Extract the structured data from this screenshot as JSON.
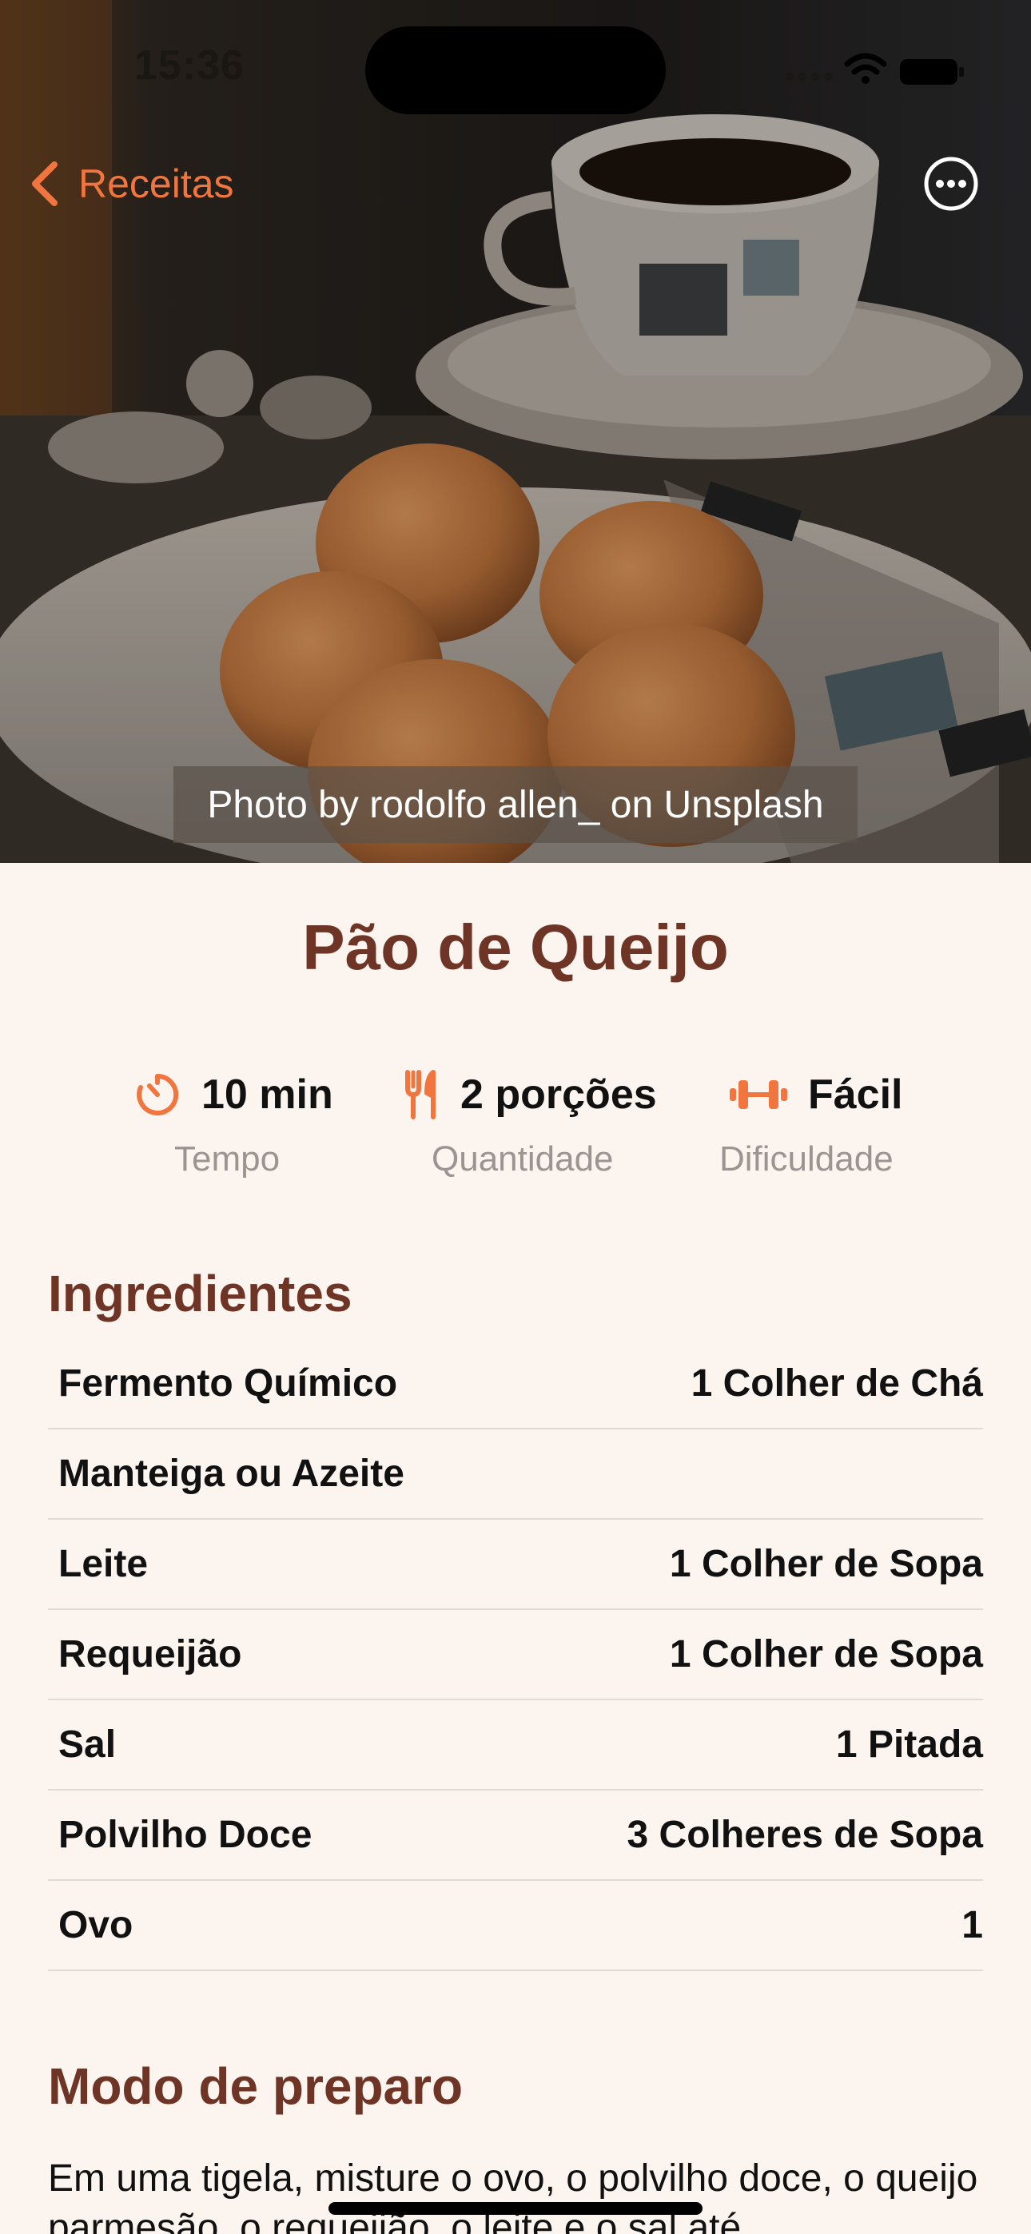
{
  "status_bar": {
    "time": "15:36"
  },
  "nav": {
    "back_label": "Receitas"
  },
  "hero": {
    "photo_credit": "Photo by rodolfo allen_ on Unsplash"
  },
  "recipe": {
    "title": "Pão de Queijo",
    "stats": [
      {
        "icon": "timer-icon",
        "value": "10 min",
        "label": "Tempo"
      },
      {
        "icon": "fork-knife-icon",
        "value": "2 porções",
        "label": "Quantidade"
      },
      {
        "icon": "dumbbell-icon",
        "value": "Fácil",
        "label": "Dificuldade"
      }
    ],
    "ingredients_title": "Ingredientes",
    "ingredients": [
      {
        "name": "Fermento Químico",
        "quantity": "1 Colher de Chá"
      },
      {
        "name": "Manteiga ou Azeite",
        "quantity": ""
      },
      {
        "name": "Leite",
        "quantity": "1 Colher de Sopa"
      },
      {
        "name": "Requeijão",
        "quantity": "1 Colher de Sopa"
      },
      {
        "name": "Sal",
        "quantity": "1 Pitada"
      },
      {
        "name": "Polvilho Doce",
        "quantity": "3 Colheres de Sopa"
      },
      {
        "name": "Ovo",
        "quantity": "1"
      }
    ],
    "preparation_title": "Modo de preparo",
    "preparation_text": "Em uma tigela, misture o ovo, o polvilho doce, o queijo parmesão, o requeijão, o leite e o sal até"
  },
  "colors": {
    "accent": "#F0753F",
    "title": "#6E3426",
    "background": "#FCF4EE"
  }
}
